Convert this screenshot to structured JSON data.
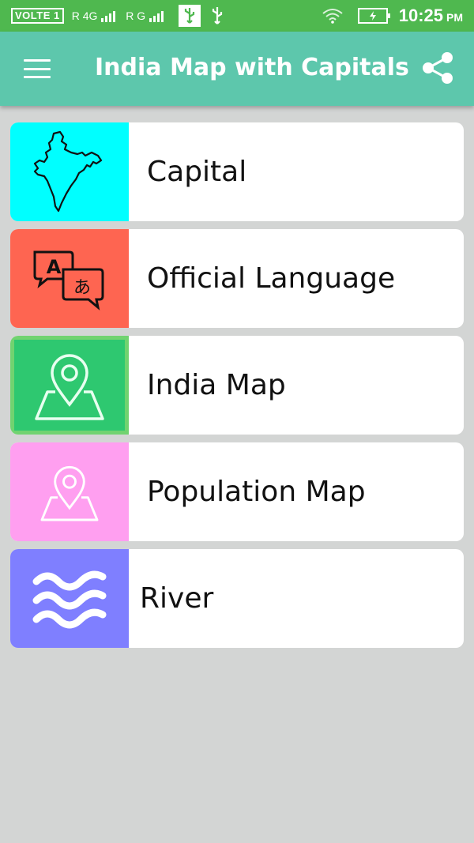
{
  "status_bar": {
    "volte": "VOLTE 1",
    "signal1": "R 4G",
    "signal2": "R G",
    "time": "10:25",
    "ampm": "PM"
  },
  "app_bar": {
    "title": "India Map with Capitals",
    "menu_icon": "hamburger-menu-icon",
    "share_icon": "share-icon"
  },
  "menu_items": [
    {
      "label": "Capital",
      "icon": "india-outline-icon",
      "color": "#00ffff"
    },
    {
      "label": "Official Language",
      "icon": "translate-icon",
      "color": "#fe6551"
    },
    {
      "label": "India Map",
      "icon": "map-pin-icon",
      "color": "#2ec870"
    },
    {
      "label": "Population Map",
      "icon": "map-pin-icon",
      "color": "#ff9ff0"
    },
    {
      "label": "River",
      "icon": "waves-icon",
      "color": "#7f7fff"
    }
  ],
  "colors": {
    "status_bar": "#4fb84f",
    "app_bar": "#5dc7ac",
    "background": "#d3d5d4"
  }
}
